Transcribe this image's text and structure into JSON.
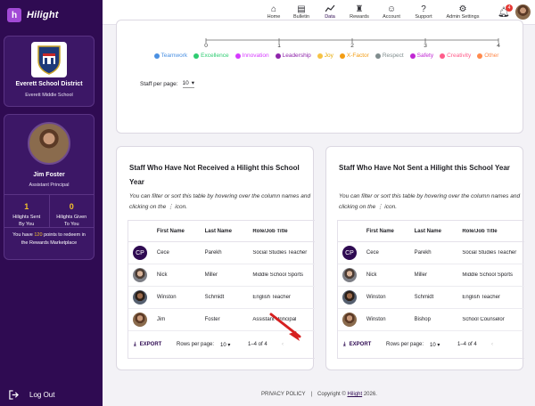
{
  "brand": {
    "name": "Hilight"
  },
  "school_card": {
    "district": "Everett School District",
    "school": "Everett Middle School"
  },
  "user_card": {
    "name": "Jim Foster",
    "role": "Assistant Principal",
    "sent_count": "1",
    "sent_label_1": "Hilights Sent",
    "sent_label_2": "By You",
    "given_count": "0",
    "given_label_1": "Hilights Given",
    "given_label_2": "To You",
    "points_prefix": "You have ",
    "points_value": "120",
    "points_suffix": " points to redeem in the Rewards Marketplace"
  },
  "logout_label": "Log Out",
  "nav": [
    {
      "label": "Home",
      "icon": "home-icon"
    },
    {
      "label": "Bulletin",
      "icon": "bulletin-icon"
    },
    {
      "label": "Data",
      "icon": "chart-icon",
      "active": true
    },
    {
      "label": "Rewards",
      "icon": "trophy-icon"
    },
    {
      "label": "Account",
      "icon": "account-icon"
    },
    {
      "label": "Support",
      "icon": "help-icon"
    },
    {
      "label": "Admin Settings",
      "icon": "gear-icon"
    }
  ],
  "notifications_count": "4",
  "top_panel": {
    "axis_ticks": [
      "0",
      "1",
      "2",
      "3",
      "4"
    ],
    "legend": [
      {
        "label": "Teamwork",
        "color": "#4a90e2"
      },
      {
        "label": "Excellence",
        "color": "#2ecc71"
      },
      {
        "label": "Innovation",
        "color": "#d63aff"
      },
      {
        "label": "Leadership",
        "color": "#8e24aa"
      },
      {
        "label": "Joy",
        "color": "#f6c244"
      },
      {
        "label": "X-Factor",
        "color": "#f39c12"
      },
      {
        "label": "Respect",
        "color": "#7f8c8d"
      },
      {
        "label": "Safety",
        "color": "#c026d3"
      },
      {
        "label": "Creativity",
        "color": "#ff5c8a"
      },
      {
        "label": "Other",
        "color": "#ff8a4c"
      }
    ],
    "staff_per_page_label": "Staff per page:",
    "staff_per_page_value": "10"
  },
  "left_table": {
    "title": "Staff Who Have Not Received a Hilight this School Year",
    "note": "You can filter or sort this table by hovering over the column names and clicking on the ⋮ icon.",
    "columns": [
      "First Name",
      "Last Name",
      "Role/Job Title"
    ],
    "rows": [
      {
        "first": "Cece",
        "last": "Parekh",
        "role": "Social Studies Teacher",
        "avatar": "CP"
      },
      {
        "first": "Nick",
        "last": "Miller",
        "role": "Middle School Sports",
        "avatar": "nick"
      },
      {
        "first": "Winston",
        "last": "Schmidt",
        "role": "English Teacher",
        "avatar": "winston"
      },
      {
        "first": "Jim",
        "last": "Foster",
        "role": "Assistant Principal",
        "avatar": "jim"
      }
    ],
    "export_label": "EXPORT",
    "rows_per_page_label": "Rows per page:",
    "rows_per_page_value": "10",
    "range": "1–4 of 4"
  },
  "right_table": {
    "title": "Staff Who Have Not Sent a Hilight this School Year",
    "note": "You can filter or sort this table by hovering over the column names and clicking on the ⋮ icon.",
    "columns": [
      "First Name",
      "Last Name",
      "Role/Job Title"
    ],
    "rows": [
      {
        "first": "Cece",
        "last": "Parekh",
        "role": "Social Studies Teacher",
        "avatar": "CP"
      },
      {
        "first": "Nick",
        "last": "Miller",
        "role": "Middle School Sports",
        "avatar": "nick"
      },
      {
        "first": "Winston",
        "last": "Schmidt",
        "role": "English Teacher",
        "avatar": "winston"
      },
      {
        "first": "Winston",
        "last": "Bishop",
        "role": "School Counselor",
        "avatar": "jim"
      }
    ],
    "export_label": "EXPORT",
    "rows_per_page_label": "Rows per page:",
    "rows_per_page_value": "10",
    "range": "1–4 of 4"
  },
  "footer": {
    "privacy": "PRIVACY POLICY",
    "sep": "|",
    "copyright_prefix": "Copyright ©",
    "copyright_brand": "Hilight",
    "copyright_year": "2026."
  }
}
